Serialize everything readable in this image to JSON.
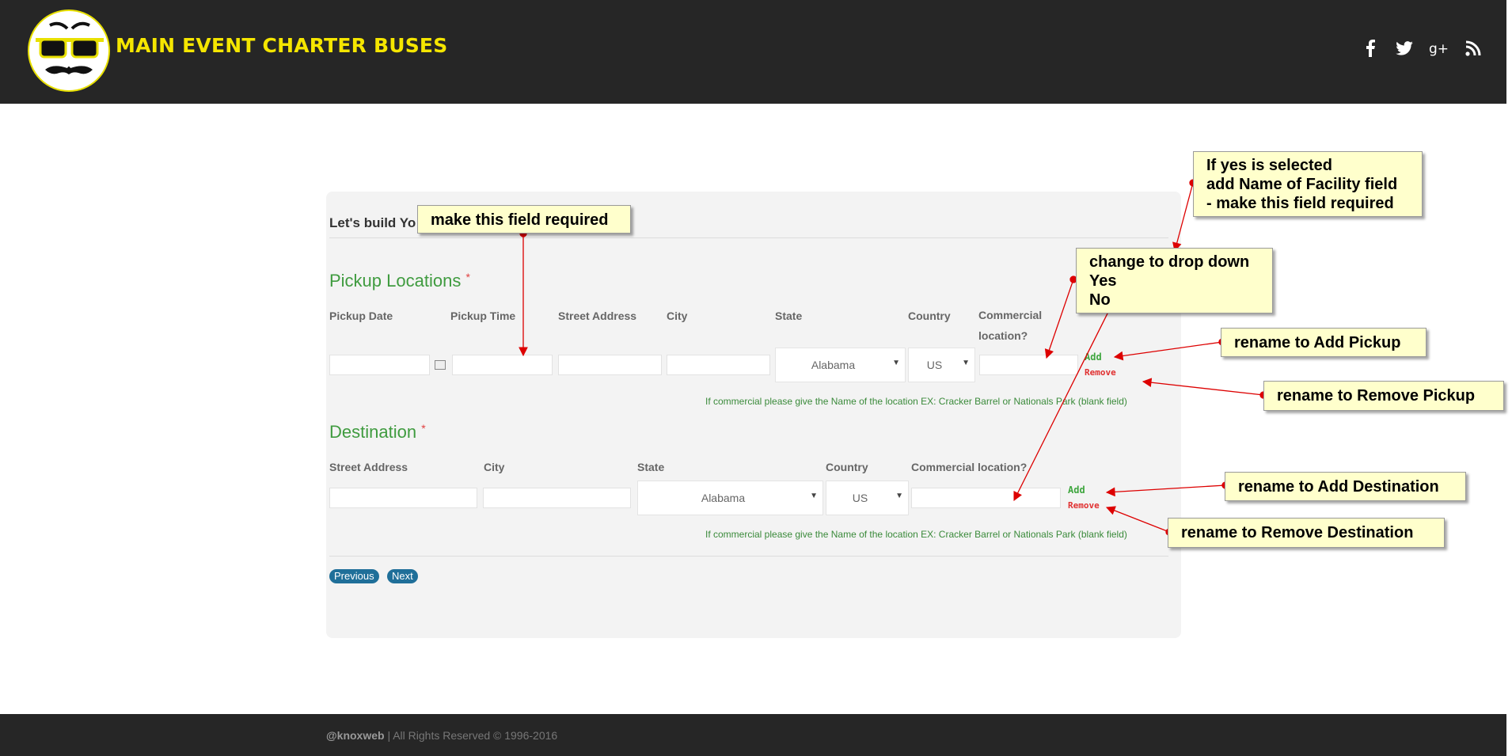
{
  "header": {
    "brand": "MAIN EVENT CHARTER BUSES",
    "social_icons": [
      "facebook-icon",
      "twitter-icon",
      "google-plus-icon",
      "rss-icon"
    ]
  },
  "form": {
    "title": "Let's build Yo",
    "pickup": {
      "heading": "Pickup Locations",
      "required_mark": "*",
      "labels": {
        "date": "Pickup Date",
        "time": "Pickup Time",
        "street": "Street Address",
        "city": "City",
        "state": "State",
        "country": "Country",
        "commercial": "Commercial location?"
      },
      "state_value": "Alabama",
      "country_value": "US",
      "add": "Add",
      "remove": "Remove",
      "hint": "If commercial please give the Name of the location EX: Cracker Barrel or Nationals Park (blank field)"
    },
    "destination": {
      "heading": "Destination",
      "required_mark": "*",
      "labels": {
        "street": "Street Address",
        "city": "City",
        "state": "State",
        "country": "Country",
        "commercial": "Commercial location?"
      },
      "state_value": "Alabama",
      "country_value": "US",
      "add": "Add",
      "remove": "Remove",
      "hint": "If commercial please give the Name of the location EX: Cracker Barrel or Nationals Park (blank field)"
    },
    "buttons": {
      "previous": "Previous",
      "next": "Next"
    }
  },
  "annotations": {
    "required_time": "make this field required",
    "facility": [
      "If yes is selected",
      "add Name of Facility field",
      "- make this field required"
    ],
    "dropdown": [
      "change to drop down",
      "Yes",
      "No"
    ],
    "add_pickup": "rename to Add Pickup",
    "remove_pickup": "rename to Remove Pickup",
    "add_destination": "rename to Add Destination",
    "remove_destination": "rename to Remove Destination",
    "color": "#ffffcc",
    "arrow_color": "#dd0000"
  },
  "footer": {
    "brand": "@knoxweb",
    "rights": " | All Rights Reserved © 1996-2016"
  },
  "colors": {
    "header_bg": "#262626",
    "brand_yellow": "#f5e600",
    "section_green": "#3f9b3f",
    "button_blue": "#1f6f99"
  }
}
